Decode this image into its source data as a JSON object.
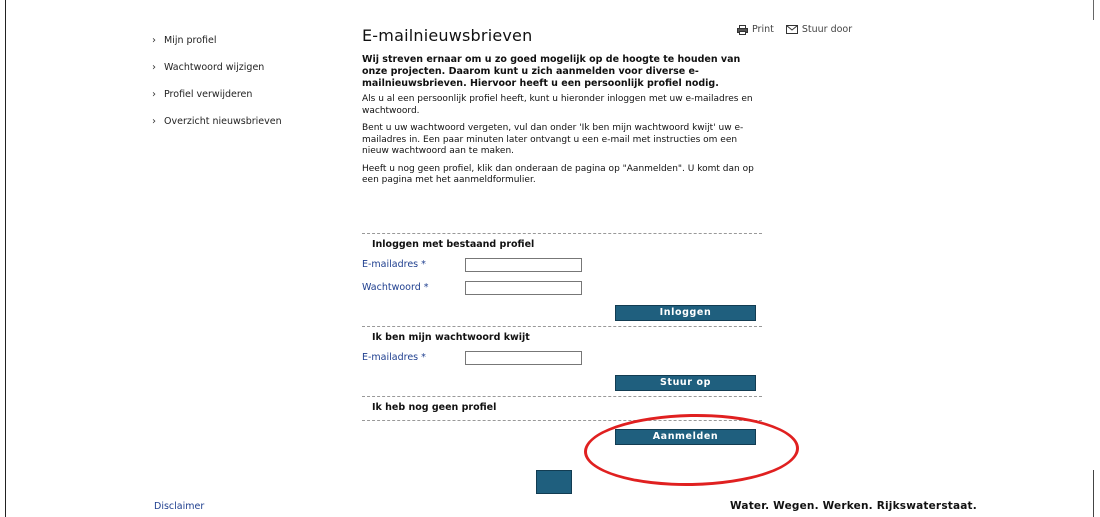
{
  "nav": {
    "items": [
      {
        "label": "Mijn profiel"
      },
      {
        "label": "Wachtwoord wijzigen"
      },
      {
        "label": "Profiel verwijderen"
      },
      {
        "label": "Overzicht nieuwsbrieven"
      }
    ]
  },
  "header": {
    "title": "E-mailnieuwsbrieven",
    "print_label": "Print",
    "forward_label": "Stuur door"
  },
  "intro": {
    "lead": "Wij streven ernaar om u zo goed mogelijk op de hoogte te houden van onze projecten. Daarom kunt u zich aanmelden voor diverse e-mailnieuwsbrieven. Hiervoor heeft u een persoonlijk profiel nodig.",
    "p1": "Als u al een persoonlijk profiel heeft, kunt u hieronder inloggen met uw e-mailadres en wachtwoord.",
    "p2": "Bent u uw wachtwoord vergeten, vul dan onder 'Ik ben mijn wachtwoord kwijt' uw e-mailadres in. Een paar minuten later ontvangt u een e-mail met instructies om een nieuw wachtwoord aan te maken.",
    "p3": "Heeft u nog geen profiel, klik dan onderaan de pagina op \"Aanmelden\". U komt dan op een pagina met het aanmeldformulier."
  },
  "login": {
    "title": "Inloggen met bestaand profiel",
    "email_label": "E-mailadres *",
    "email_value": "",
    "password_label": "Wachtwoord *",
    "password_value": "",
    "button": "Inloggen"
  },
  "forgot": {
    "title": "Ik ben mijn wachtwoord kwijt",
    "email_label": "E-mailadres *",
    "email_value": "",
    "button": "Stuur op"
  },
  "register": {
    "title": "Ik heb nog geen profiel",
    "button": "Aanmelden"
  },
  "footer": {
    "disclaimer": "Disclaimer",
    "slogan": "Water. Wegen. Werken. Rijkswaterstaat."
  },
  "colors": {
    "button": "#1f5f7e",
    "link": "#1f3f8f",
    "highlight": "#e02020"
  }
}
